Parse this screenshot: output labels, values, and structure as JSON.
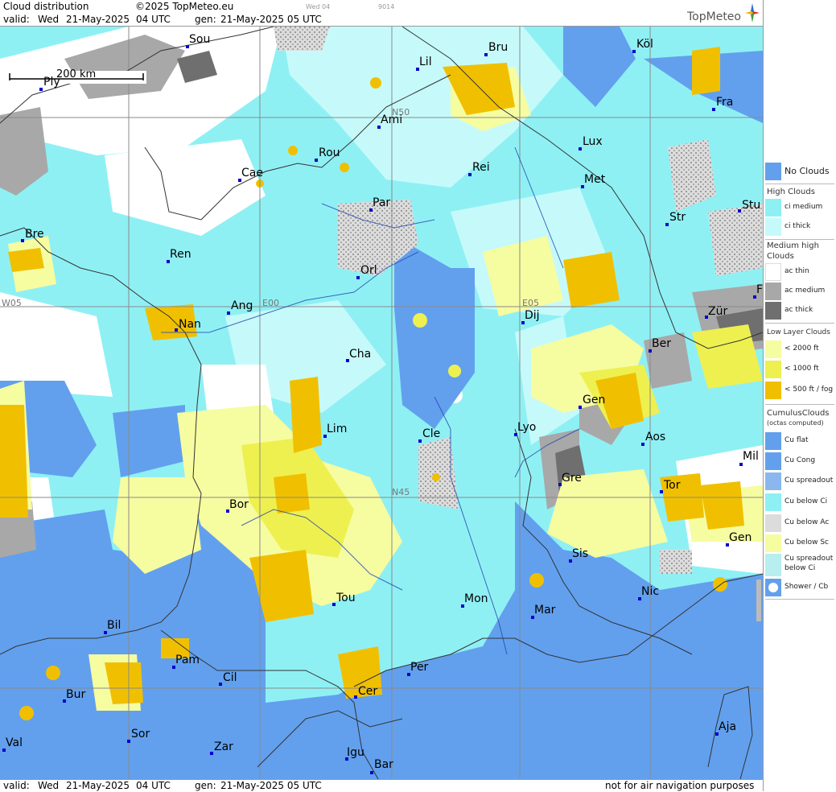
{
  "header": {
    "title": "Cloud distribution",
    "copyright": "©2025 TopMeteo.eu",
    "valid_label": "valid:",
    "valid_day": "Wed",
    "valid_date": "21-May-2025",
    "valid_time": "04 UTC",
    "gen_label": "gen:",
    "gen_date": "21-May-2025 05 UTC",
    "tiny_day": "Wed 04",
    "tiny_code": "9014",
    "brand": "TopMeteo"
  },
  "scale": {
    "label": "200 km"
  },
  "grid_labels": {
    "n50": "N50",
    "n45": "N45",
    "w05": "W05",
    "e00": "E00",
    "e05": "E05"
  },
  "cities": [
    {
      "name": "Sou"
    },
    {
      "name": "Ply"
    },
    {
      "name": "Bru"
    },
    {
      "name": "Köl"
    },
    {
      "name": "Lil"
    },
    {
      "name": "Fra"
    },
    {
      "name": "Ami"
    },
    {
      "name": "Lux"
    },
    {
      "name": "Rou"
    },
    {
      "name": "Cae"
    },
    {
      "name": "Rei"
    },
    {
      "name": "Met"
    },
    {
      "name": "Par"
    },
    {
      "name": "Stu"
    },
    {
      "name": "Bre"
    },
    {
      "name": "Str"
    },
    {
      "name": "Ren"
    },
    {
      "name": "Orl"
    },
    {
      "name": "Ang"
    },
    {
      "name": "Dij"
    },
    {
      "name": "Zür"
    },
    {
      "name": "Nan"
    },
    {
      "name": "Cha"
    },
    {
      "name": "Ber"
    },
    {
      "name": "Gen"
    },
    {
      "name": "Lim"
    },
    {
      "name": "Cle"
    },
    {
      "name": "Lyo"
    },
    {
      "name": "Aos"
    },
    {
      "name": "Mil"
    },
    {
      "name": "Gre"
    },
    {
      "name": "Tor"
    },
    {
      "name": "Bor"
    },
    {
      "name": "Gen"
    },
    {
      "name": "Sis"
    },
    {
      "name": "Nic"
    },
    {
      "name": "Tou"
    },
    {
      "name": "Mon"
    },
    {
      "name": "Mar"
    },
    {
      "name": "Bil"
    },
    {
      "name": "Pam"
    },
    {
      "name": "Per"
    },
    {
      "name": "Cil"
    },
    {
      "name": "Bur"
    },
    {
      "name": "Cer"
    },
    {
      "name": "Sor"
    },
    {
      "name": "Aja"
    },
    {
      "name": "Val"
    },
    {
      "name": "Zar"
    },
    {
      "name": "Igu"
    },
    {
      "name": "Bar"
    },
    {
      "name": "F"
    }
  ],
  "legend": {
    "no_clouds": "No Clouds",
    "high_title": "High Clouds",
    "ci_medium": "ci medium",
    "ci_thick": "ci thick",
    "medium_title_1": "Medium high",
    "medium_title_2": "Clouds",
    "ac_thin": "ac thin",
    "ac_medium": "ac medium",
    "ac_thick": "ac thick",
    "low_title": "Low Layer Clouds",
    "low_2000": "< 2000 ft",
    "low_1000": "< 1000 ft",
    "low_500": "< 500 ft / fog",
    "cu_title": "CumulusClouds",
    "cu_subtitle": "(octas computed)",
    "cu_flat": "Cu flat",
    "cu_cong": "Cu Cong",
    "cu_spreadout": "Cu spreadout",
    "cu_below_ci": "Cu below Ci",
    "cu_below_ac": "Cu below Ac",
    "cu_below_sc": "Cu below Sc",
    "cu_spreadout_ci_1": "Cu spreadout",
    "cu_spreadout_ci_2": "below Ci",
    "shower": "Shower / Cb",
    "colors": {
      "no_clouds": "#62a0ee",
      "ci_medium": "#8ff0f4",
      "ci_thick": "#c6fafa",
      "ac_thin": "#ffffff",
      "ac_medium": "#a8a8a8",
      "ac_thick": "#6f6f6f",
      "low_2000": "#f6fca0",
      "low_1000": "#eef050",
      "low_500": "#f0c000"
    }
  },
  "footer": {
    "valid_label": "valid:",
    "valid_day": "Wed",
    "valid_date": "21-May-2025",
    "valid_time": "04 UTC",
    "gen_label": "gen:",
    "gen_date": "21-May-2025 05 UTC",
    "disclaimer": "not for air navigation purposes"
  }
}
